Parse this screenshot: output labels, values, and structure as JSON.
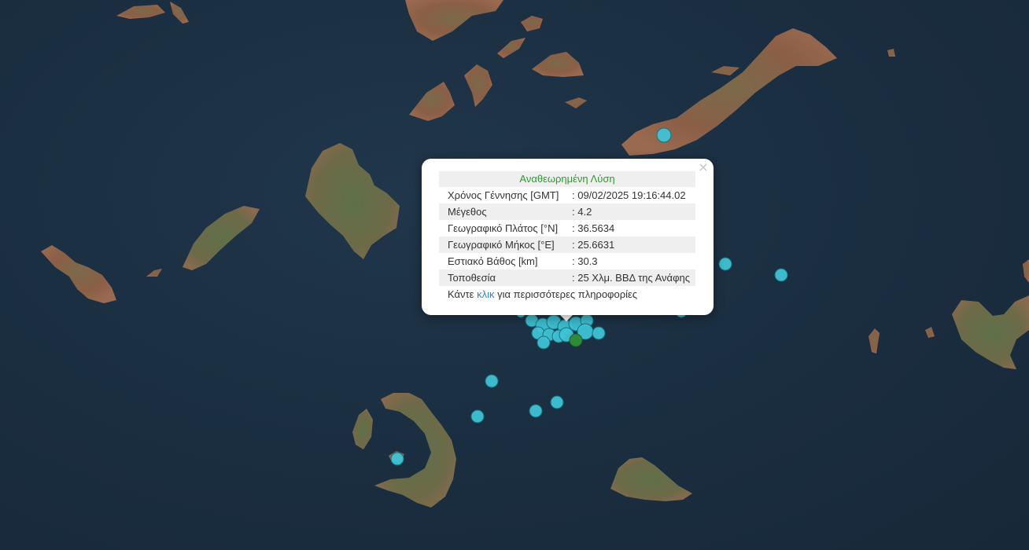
{
  "map": {
    "land_color": "#8a6a4e",
    "vegetation_color": "#5b6b42",
    "sea_color": "#1b2d3e",
    "marker_color": "#3ec3d4",
    "marker_highlight_color": "#2e8b3a"
  },
  "popup": {
    "close_symbol": "×",
    "title": "Αναθεωρημένη Λύση",
    "title_color": "#2c9a2c",
    "rows": [
      {
        "label": "Χρόνος Γέννησης [GMT]",
        "value": ": 09/02/2025 19:16:44.02"
      },
      {
        "label": "Μέγεθος",
        "value": ": 4.2"
      },
      {
        "label": "Γεωγραφικό Πλάτος [°N]",
        "value": ": 36.5634"
      },
      {
        "label": "Γεωγραφικό Μήκος [°E]",
        "value": ": 25.6631"
      },
      {
        "label": "Εστιακό Βάθος [km]",
        "value": ": 30.3"
      },
      {
        "label": "Τοποθεσία",
        "value": ": 25 Χλμ. ΒΒΔ της Ανάφης"
      }
    ],
    "footer_prefix": "Κάντε ",
    "footer_link": "κλικ",
    "footer_suffix": " για περισσότερες πληροφορίες"
  }
}
